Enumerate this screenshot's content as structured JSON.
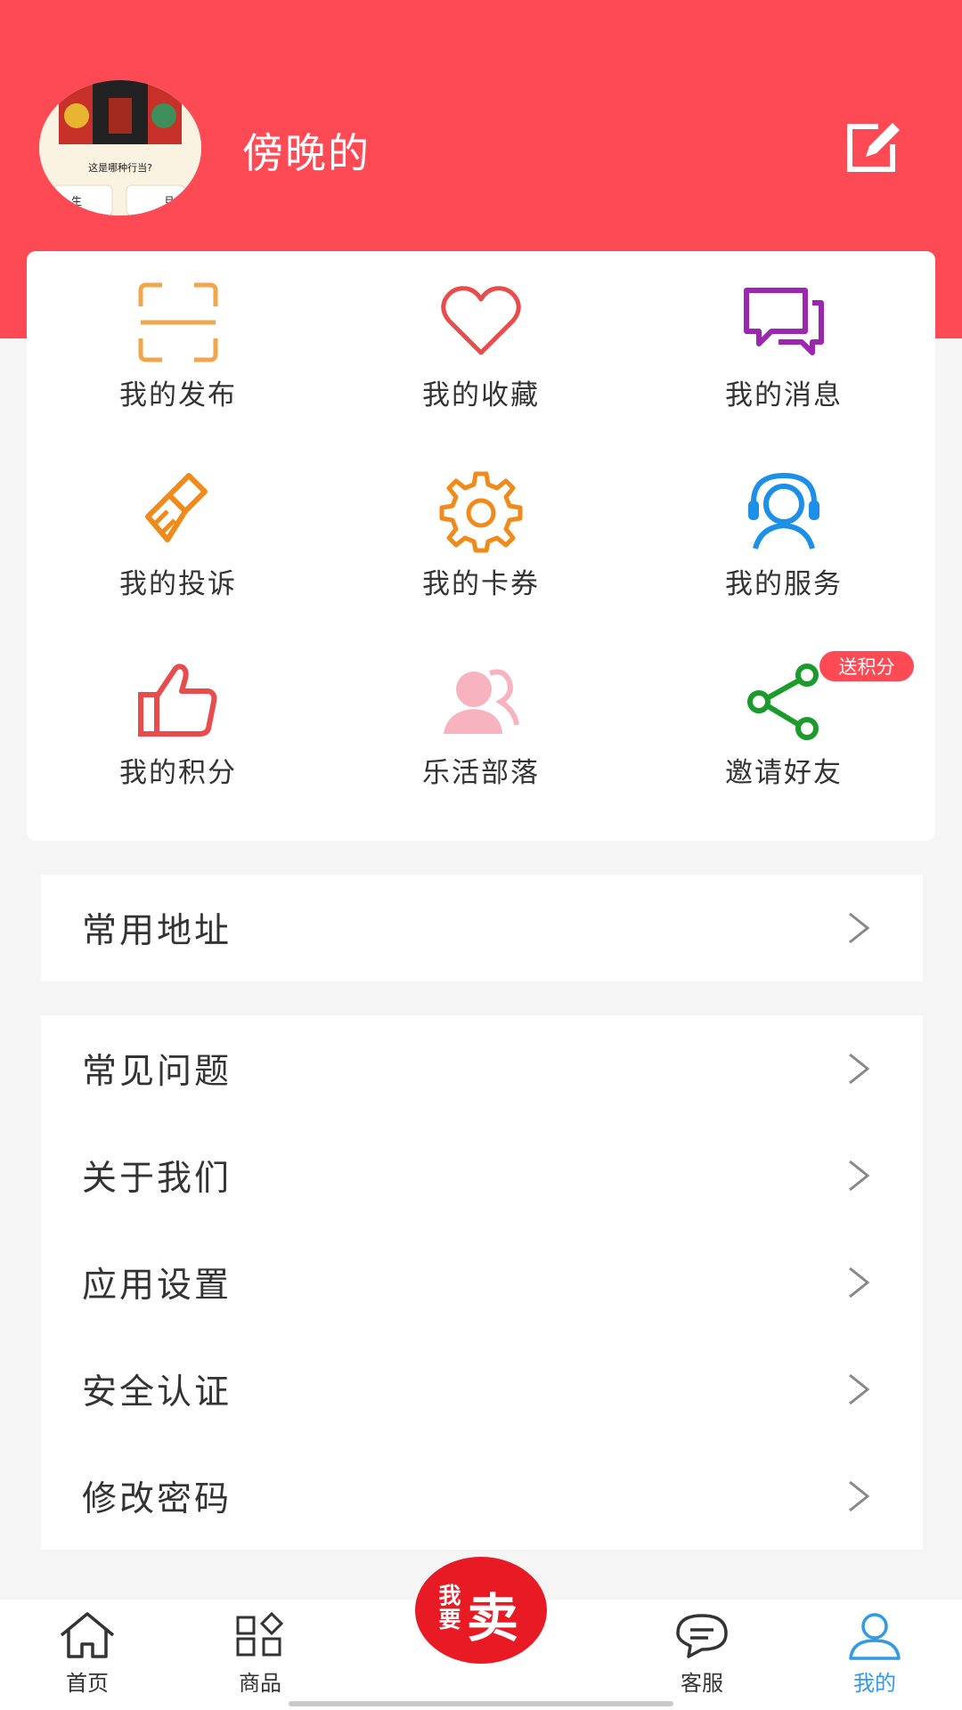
{
  "profile": {
    "username": "傍晚的",
    "avatar_caption": "这是哪种行当?",
    "avatar_option_left": "生",
    "avatar_option_right": "旦"
  },
  "grid": {
    "items": [
      {
        "label": "我的发布",
        "icon": "scan-frame-icon",
        "color": "#f2a64a"
      },
      {
        "label": "我的收藏",
        "icon": "heart-icon",
        "color": "#e84c4c"
      },
      {
        "label": "我的消息",
        "icon": "chat-bubbles-icon",
        "color": "#9b27b0"
      },
      {
        "label": "我的投诉",
        "icon": "brush-icon",
        "color": "#f08a1a"
      },
      {
        "label": "我的卡券",
        "icon": "gear-icon",
        "color": "#f08a1a"
      },
      {
        "label": "我的服务",
        "icon": "customer-service-icon",
        "color": "#1c8fe8"
      },
      {
        "label": "我的积分",
        "icon": "thumbs-up-icon",
        "color": "#e84c4c"
      },
      {
        "label": "乐活部落",
        "icon": "people-icon",
        "color": "#f7b4c0"
      },
      {
        "label": "邀请好友",
        "icon": "share-icon",
        "color": "#1a9b2c"
      }
    ],
    "invite_badge": "送积分"
  },
  "menu_group_1": [
    {
      "label": "常用地址"
    }
  ],
  "menu_group_2": [
    {
      "label": "常见问题"
    },
    {
      "label": "关于我们"
    },
    {
      "label": "应用设置"
    },
    {
      "label": "安全认证"
    },
    {
      "label": "修改密码"
    }
  ],
  "tabbar": {
    "tabs": [
      {
        "label": "首页",
        "icon": "home-icon"
      },
      {
        "label": "商品",
        "icon": "category-icon"
      },
      {
        "label": "客服",
        "icon": "chat-icon"
      },
      {
        "label": "我的",
        "icon": "user-icon",
        "active": true
      }
    ],
    "sell_small": "我要",
    "sell_big": "卖"
  },
  "colors": {
    "header": "#fd4a55",
    "active_tab": "#2f9be8",
    "sell_button": "#e81a24"
  }
}
